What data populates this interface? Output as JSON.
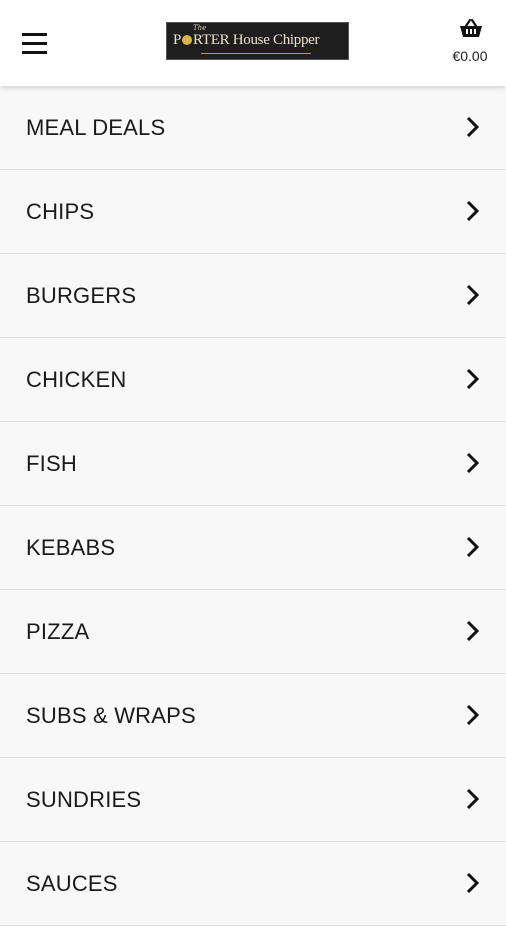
{
  "header": {
    "menu_icon": "hamburger-menu-icon",
    "logo": {
      "small": "The",
      "text_part1": "P",
      "text_part2": "RTER ",
      "text_part3": "House Chipper",
      "full_name": "The Porter House Chipper"
    },
    "cart": {
      "icon": "basket-icon",
      "total": "€0.00"
    }
  },
  "categories": [
    {
      "label": "MEAL DEALS"
    },
    {
      "label": "CHIPS"
    },
    {
      "label": "BURGERS"
    },
    {
      "label": "CHICKEN"
    },
    {
      "label": "FISH"
    },
    {
      "label": "KEBABS"
    },
    {
      "label": "PIZZA"
    },
    {
      "label": "SUBS & WRAPS"
    },
    {
      "label": "SUNDRIES"
    },
    {
      "label": "SAUCES"
    }
  ],
  "colors": {
    "row_background": "#f8f8f8",
    "divider": "#dedede",
    "text": "#1a1a1a",
    "logo_background": "#1e1e1e",
    "logo_accent": "#d9b44a"
  }
}
